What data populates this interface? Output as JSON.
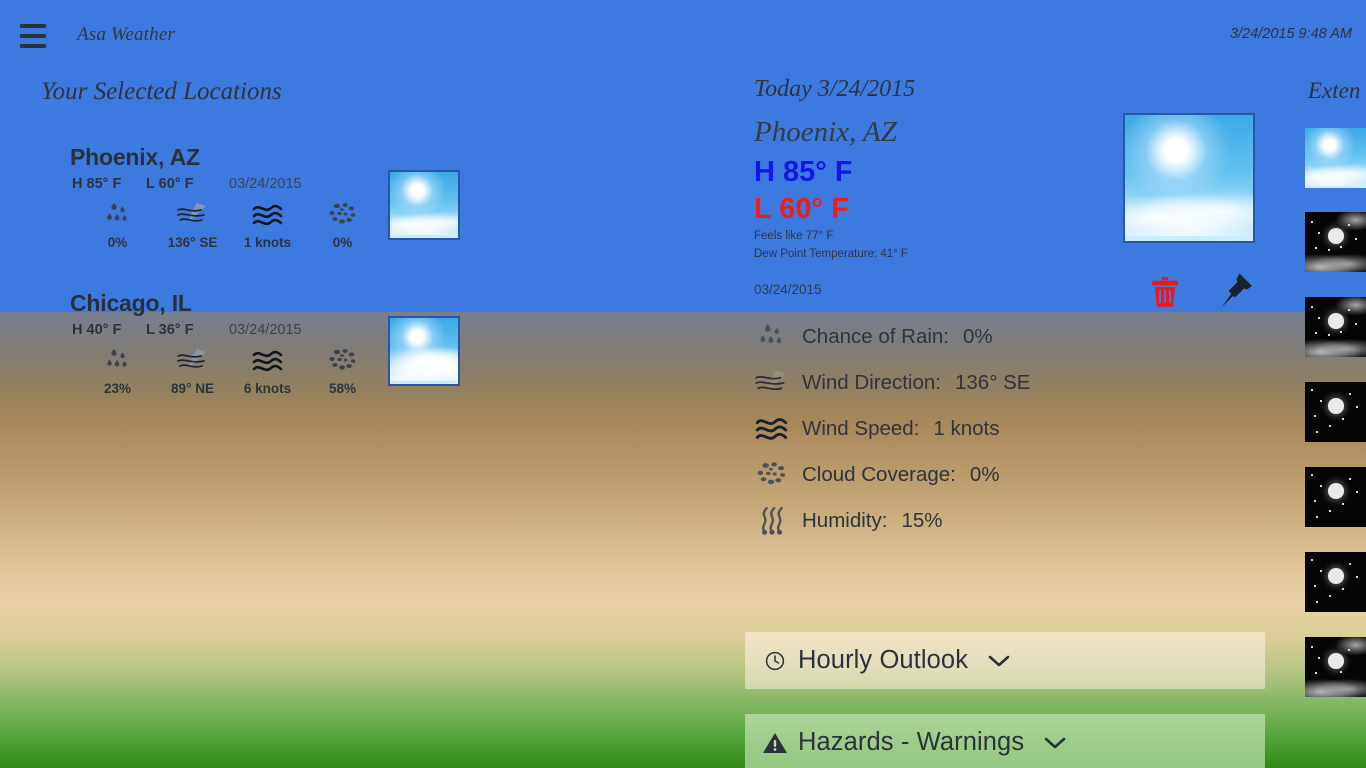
{
  "topbar": {
    "menu_icon": "hamburger-icon",
    "app_title": "Asa Weather",
    "clock": "3/24/2015 9:48 AM"
  },
  "left_panel": {
    "heading": "Your Selected Locations",
    "locations": [
      {
        "name": "Phoenix, AZ",
        "high": "H 85° F",
        "low": "L 60° F",
        "date": "03/24/2015",
        "condition_image": "sunny-clear-sky",
        "metrics": [
          {
            "icon": "rain-drops-icon",
            "value": "0%"
          },
          {
            "icon": "wind-direction-icon",
            "value": "136° SE"
          },
          {
            "icon": "wind-speed-icon",
            "value": "1 knots"
          },
          {
            "icon": "cloud-coverage-icon",
            "value": "0%"
          }
        ]
      },
      {
        "name": "Chicago, IL",
        "high": "H 40° F",
        "low": "L 36° F",
        "date": "03/24/2015",
        "condition_image": "sun-with-clouds",
        "metrics": [
          {
            "icon": "rain-drops-icon",
            "value": "23%"
          },
          {
            "icon": "wind-direction-icon",
            "value": "89° NE"
          },
          {
            "icon": "wind-speed-icon",
            "value": "6 knots"
          },
          {
            "icon": "cloud-coverage-icon",
            "value": "58%"
          }
        ]
      }
    ]
  },
  "center_panel": {
    "today_label": "Today 3/24/2015",
    "city": "Phoenix, AZ",
    "high": "H 85° F",
    "low": "L 60° F",
    "feels_like": "Feels like 77° F",
    "dew_point": "Dew Point Temperature: 41° F",
    "date": "03/24/2015",
    "condition_image": "sunny-clear-sky",
    "delete_icon": "trash-icon",
    "pin_icon": "pushpin-icon",
    "high_color": "#1414ee",
    "low_color": "#ef1c1c",
    "delete_color": "#f21616",
    "details": [
      {
        "icon": "rain-drops-icon",
        "label": "Chance of Rain:",
        "value": "0%"
      },
      {
        "icon": "wind-direction-icon",
        "label": "Wind Direction:",
        "value": "136° SE"
      },
      {
        "icon": "wind-speed-icon",
        "label": "Wind Speed:",
        "value": "1 knots"
      },
      {
        "icon": "cloud-coverage-icon",
        "label": "Cloud Coverage:",
        "value": "0%"
      },
      {
        "icon": "humidity-icon",
        "label": "Humidity:",
        "value": "15%"
      }
    ],
    "accordions": [
      {
        "icon": "clock-icon",
        "label": "Hourly Outlook",
        "chevron": "chevron-down-icon",
        "state": "collapsed"
      },
      {
        "icon": "warning-icon",
        "label": "Hazards - Warnings",
        "chevron": "chevron-down-icon",
        "state": "collapsed"
      }
    ]
  },
  "right_panel": {
    "heading": "Exten",
    "thumbnails": [
      {
        "image": "sunny-clear-sky"
      },
      {
        "image": "clear-night-with-clouds"
      },
      {
        "image": "clear-night-with-clouds"
      },
      {
        "image": "clear-night"
      },
      {
        "image": "clear-night"
      },
      {
        "image": "clear-night"
      },
      {
        "image": "clear-night-with-clouds"
      }
    ]
  },
  "theme": {
    "sky_color": "#3d7ae0",
    "ground_top": "#76808f",
    "ground_bottom": "#2e8b16"
  }
}
